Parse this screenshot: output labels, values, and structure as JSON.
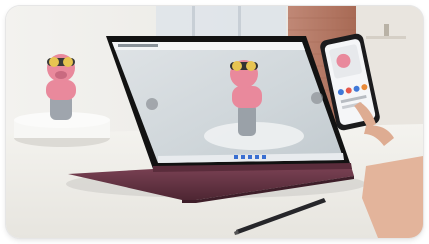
{
  "photo": {
    "subject": "convertible-laptop-tent-mode-with-phone-and-stylus",
    "colors": {
      "wall": "#ecebe7",
      "window": "#dde4ea",
      "brick": "#b0705a",
      "table": "#efeee9",
      "laptop_body": "#6a3748",
      "laptop_body_dark": "#3e1e29",
      "bezel": "#121212",
      "figure_pink": "#e9899c",
      "figure_gray": "#9fa5ad",
      "goggles_yellow": "#e7c451",
      "phone_accent": "#3f78d8",
      "stylus": "#26262a",
      "hand": "#e3b49b"
    }
  }
}
